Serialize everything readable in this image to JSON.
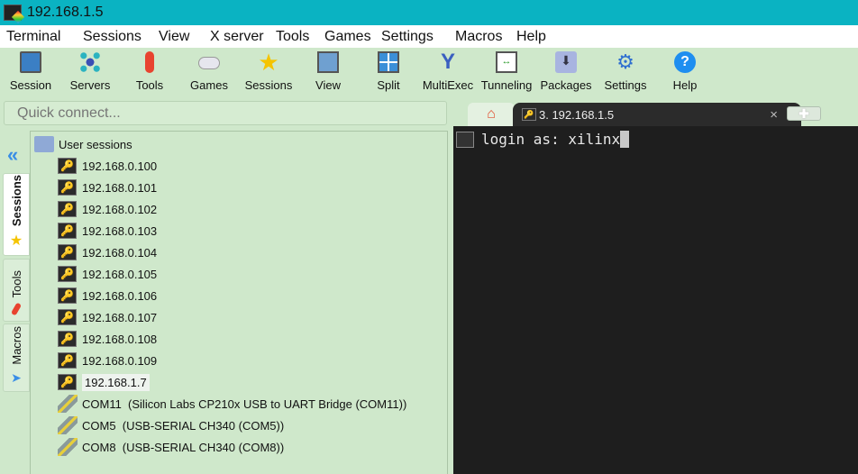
{
  "window": {
    "title": "192.168.1.5"
  },
  "menu": [
    "Terminal",
    "Sessions",
    "View",
    "X server",
    "Tools",
    "Games",
    "Settings",
    "Macros",
    "Help"
  ],
  "toolbar": [
    {
      "label": "Session",
      "icon": "session-icon"
    },
    {
      "label": "Servers",
      "icon": "servers-icon"
    },
    {
      "label": "Tools",
      "icon": "tools-icon"
    },
    {
      "label": "Games",
      "icon": "games-icon"
    },
    {
      "label": "Sessions",
      "icon": "star-icon"
    },
    {
      "label": "View",
      "icon": "view-icon"
    },
    {
      "label": "Split",
      "icon": "split-icon"
    },
    {
      "label": "MultiExec",
      "icon": "multiexec-icon"
    },
    {
      "label": "Tunneling",
      "icon": "tunneling-icon"
    },
    {
      "label": "Packages",
      "icon": "packages-icon"
    },
    {
      "label": "Settings",
      "icon": "settings-icon"
    },
    {
      "label": "Help",
      "icon": "help-icon"
    }
  ],
  "quick_connect": {
    "placeholder": "Quick connect..."
  },
  "side_tabs": [
    "Sessions",
    "Tools",
    "Macros"
  ],
  "sessions": {
    "root": "User sessions",
    "items": [
      "192.168.0.100",
      "192.168.0.101",
      "192.168.0.102",
      "192.168.0.103",
      "192.168.0.104",
      "192.168.0.105",
      "192.168.0.106",
      "192.168.0.107",
      "192.168.0.108",
      "192.168.0.109",
      "192.168.1.7"
    ],
    "serial": [
      "COM11  (Silicon Labs CP210x USB to UART Bridge (COM11))",
      "COM5  (USB-SERIAL CH340 (COM5))",
      "COM8  (USB-SERIAL CH340 (COM8))"
    ]
  },
  "tabs": {
    "active": "3. 192.168.1.5"
  },
  "terminal": {
    "line": "login as: xilinx"
  },
  "colors": {
    "titlebar": "#0ab3c2",
    "panel": "#cfe8cb",
    "terminal": "#1e1e1e"
  }
}
